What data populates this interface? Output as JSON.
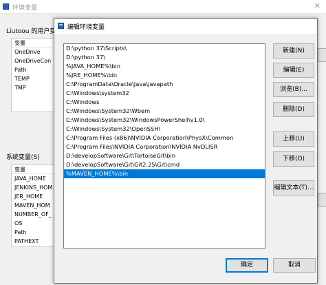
{
  "background_window": {
    "title": "环境变量",
    "user_vars_label": "Liutoou 的用户变",
    "user_vars_header": "变量",
    "user_vars": [
      "OneDrive",
      "OneDriveCon",
      "Path",
      "TEMP",
      "TMP"
    ],
    "system_vars_label": "系统变量(S)",
    "system_vars_header": "变量",
    "system_vars": [
      "JAVA_HOME",
      "JENKINS_HOM",
      "JER_HOME",
      "MAVEN_HOM",
      "NUMBER_OF_",
      "OS",
      "Path",
      "PATHEXT"
    ]
  },
  "dialog": {
    "title": "编辑环境变量",
    "paths": [
      "D:\\python 37\\Scripts\\",
      "D:\\python 37\\",
      "%JAVA_HOME%\\bin",
      "%JRE_HOME%\\bin",
      "C:\\ProgramData\\Oracle\\Java\\javapath",
      "C:\\Windows\\system32",
      "C:\\Windows",
      "C:\\Windows\\System32\\Wbem",
      "C:\\Windows\\System32\\WindowsPowerShell\\v1.0\\",
      "C:\\Windows\\System32\\OpenSSH\\",
      "C:\\Program Files (x86)\\NVIDIA Corporation\\PhysX\\Common",
      "C:\\Program Files\\NVIDIA Corporation\\NVIDIA NvDLISR",
      "D:\\developSoftware\\Git\\TortoiseGit\\bin",
      "D:\\developSoftware\\Git\\Git2.25\\Git\\cmd",
      "%MAVEN_HOME%\\bin"
    ],
    "selected_index": 14,
    "buttons": {
      "new": "新建(N)",
      "edit": "编辑(E)",
      "browse": "浏览(B)...",
      "delete": "删除(D)",
      "move_up": "上移(U)",
      "move_down": "下移(O)",
      "edit_text": "编辑文本(T)..."
    },
    "ok": "确定",
    "cancel": "取消"
  }
}
